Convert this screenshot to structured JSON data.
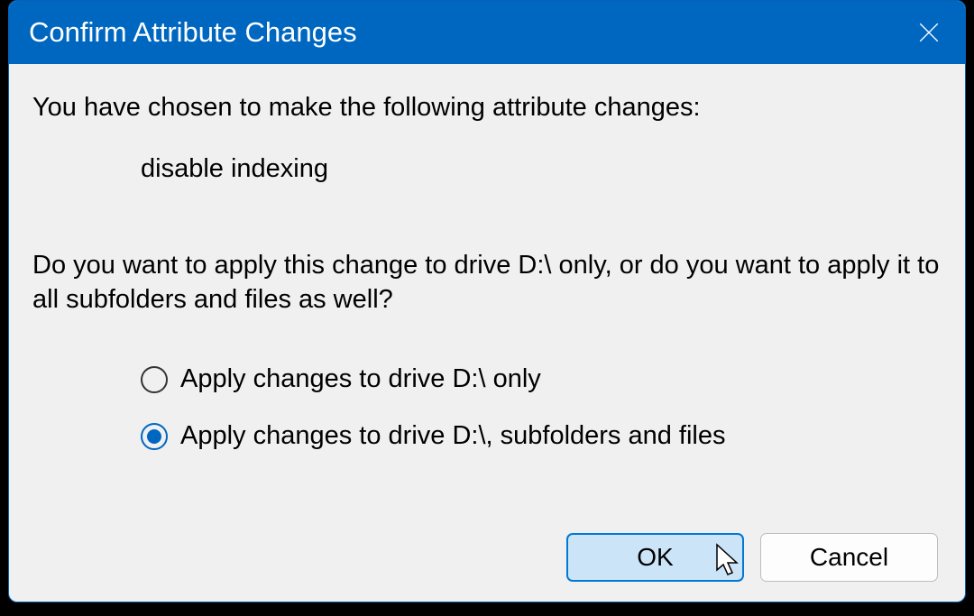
{
  "titlebar": {
    "title": "Confirm Attribute Changes"
  },
  "content": {
    "intro": "You have chosen to make the following attribute changes:",
    "change_desc": "disable indexing",
    "question": "Do you want to apply this change to drive D:\\ only, or do you want to apply it to all subfolders and files as well?",
    "options": [
      {
        "label": "Apply changes to drive D:\\ only",
        "selected": false
      },
      {
        "label": "Apply changes to drive D:\\, subfolders and files",
        "selected": true
      }
    ]
  },
  "buttons": {
    "ok": "OK",
    "cancel": "Cancel"
  }
}
